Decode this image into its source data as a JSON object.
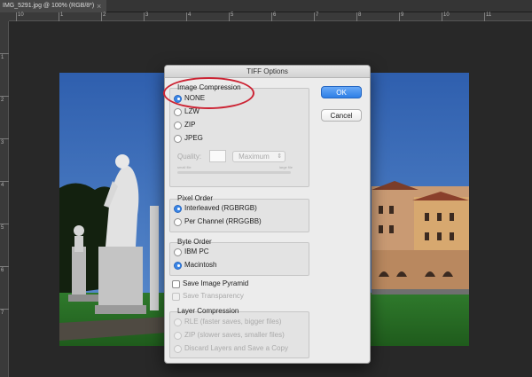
{
  "document_tab": {
    "label": "IMG_5291.jpg @ 100% (RGB/8*)",
    "close_glyph": "×"
  },
  "ruler_top_numbers": [
    "10",
    "1",
    "2",
    "3",
    "4",
    "5",
    "6",
    "7",
    "8",
    "9",
    "10",
    "11"
  ],
  "ruler_left_numbers": [
    "1",
    "2",
    "3",
    "4",
    "5",
    "6",
    "7"
  ],
  "dialog": {
    "title": "TIFF Options",
    "ok_label": "OK",
    "cancel_label": "Cancel",
    "image_compression": {
      "title": "Image Compression",
      "options": [
        "NONE",
        "LZW",
        "ZIP",
        "JPEG"
      ],
      "selected": "NONE",
      "quality_label": "Quality:",
      "quality_value": "",
      "quality_select": "Maximum",
      "slider_left_label": "small file",
      "slider_right_label": "large file"
    },
    "pixel_order": {
      "title": "Pixel Order",
      "options": [
        "Interleaved (RGBRGB)",
        "Per Channel (RRGGBB)"
      ],
      "selected": "Interleaved (RGBRGB)"
    },
    "byte_order": {
      "title": "Byte Order",
      "options": [
        "IBM PC",
        "Macintosh"
      ],
      "selected": "Macintosh"
    },
    "save_image_pyramid": "Save Image Pyramid",
    "save_transparency": "Save Transparency",
    "layer_compression": {
      "title": "Layer Compression",
      "options": [
        "RLE (faster saves, bigger files)",
        "ZIP (slower saves, smaller files)",
        "Discard Layers and Save a Copy"
      ]
    }
  },
  "colors": {
    "annotation": "#cc2434",
    "accent": "#2e7fe6",
    "sky": "#3a6bb5"
  }
}
